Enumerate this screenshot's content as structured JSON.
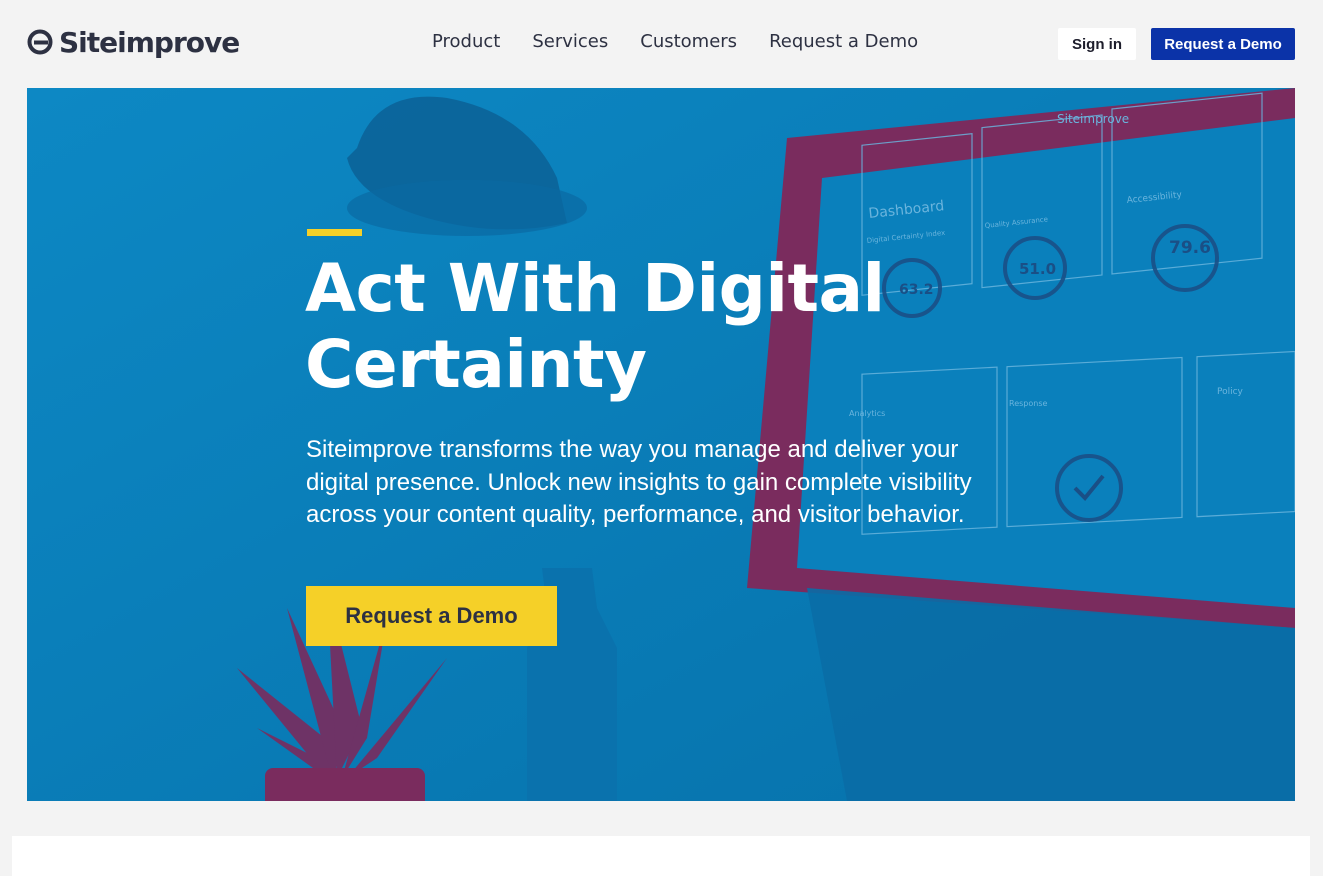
{
  "brand": {
    "name": "Siteimprove",
    "accent": "#f5d028",
    "primary": "#0b33a8",
    "hero_bg": "#0a7bb5"
  },
  "nav": {
    "items": [
      {
        "label": "Product"
      },
      {
        "label": "Services"
      },
      {
        "label": "Customers"
      },
      {
        "label": "Request a Demo"
      }
    ]
  },
  "header": {
    "signin_label": "Sign in",
    "demo_label": "Request a Demo"
  },
  "hero": {
    "title": "Act With Digital Certainty",
    "description": "Siteimprove transforms the way you manage and deliver your digital presence. Unlock new insights to gain complete visibility across your content quality, performance, and visitor behavior.",
    "cta_label": "Request a Demo",
    "background": {
      "monitor_brand": "Siteimprove",
      "dashboard_title": "Dashboard",
      "panels": [
        {
          "title": "Digital Certainty Index",
          "score": "63.2"
        },
        {
          "title": "Quality Assurance",
          "score": "51.0"
        },
        {
          "title": "Accessibility",
          "score": "79.6"
        },
        {
          "title": "Analytics"
        },
        {
          "title": "Response"
        },
        {
          "title": "Policy"
        }
      ]
    }
  }
}
